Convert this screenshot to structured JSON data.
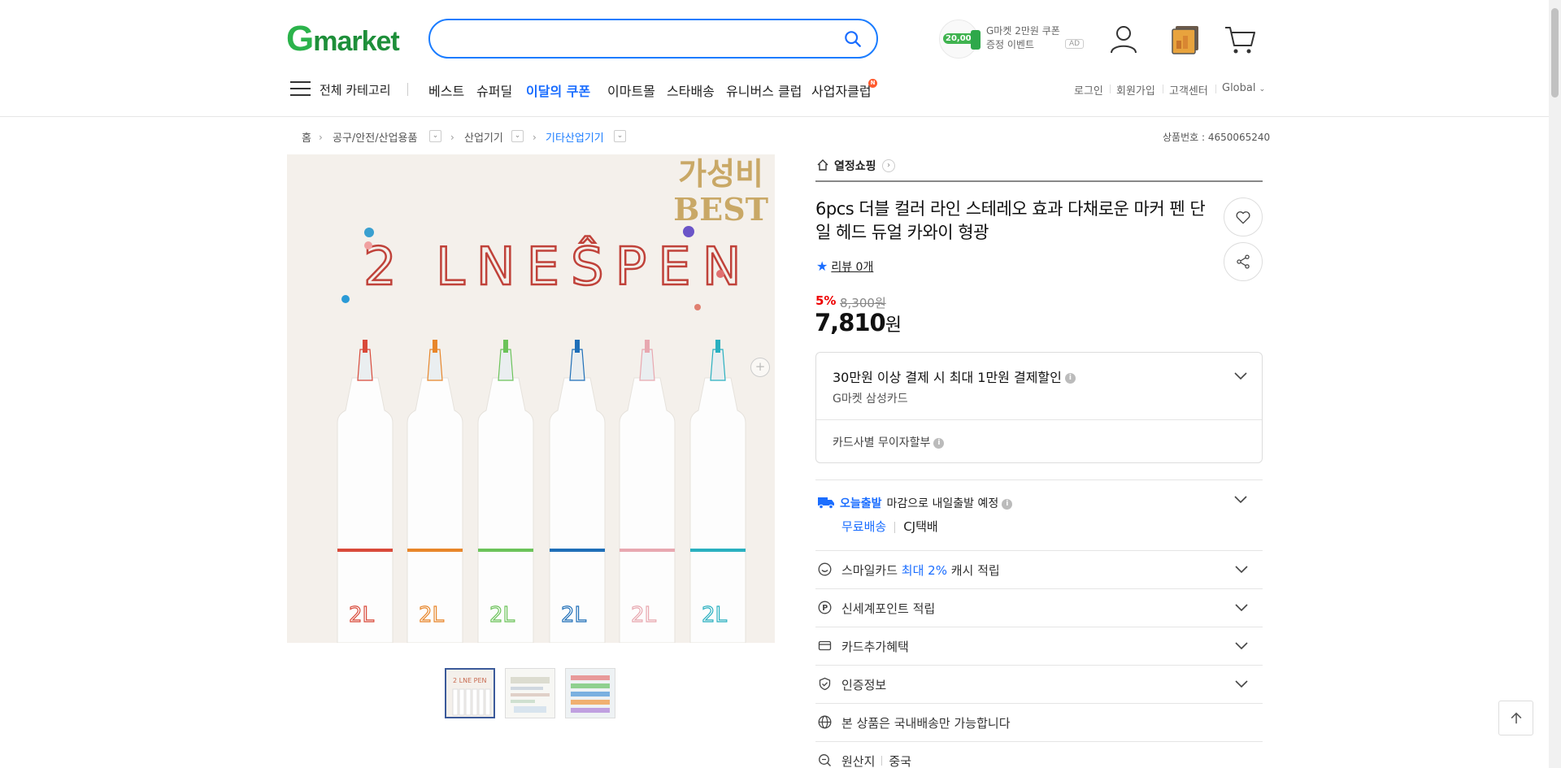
{
  "header": {
    "logo": {
      "g": "G",
      "rest": "market"
    },
    "search": {
      "value": "",
      "placeholder": ""
    },
    "promo": {
      "amount": "20,000",
      "line1": "G마켓 2만원 쿠폰",
      "line2": "증정 이벤트",
      "ad": "AD"
    },
    "all_category": "전체 카테고리",
    "nav": [
      "베스트",
      "슈퍼딜",
      "이달의 쿠폰",
      "이마트몰",
      "스타배송",
      "유니버스 클럽",
      "사업자클럽"
    ],
    "nav_badge": "N",
    "util": [
      "로그인",
      "회원가입",
      "고객센터",
      "Global"
    ]
  },
  "breadcrumb": {
    "items": [
      "홈",
      "공구/안전/산업용품",
      "산업기기",
      "기타산업기기"
    ],
    "product_no": "상품번호 : 4650065240"
  },
  "image": {
    "badge_line1": "가성비",
    "badge_line2": "BEST",
    "product_text": "2 LNEŜPEN"
  },
  "product": {
    "shop": "열정쇼핑",
    "title": "6pcs 더블 컬러 라인 스테레오 효과 다채로운 마커 펜 단일 헤드 듀얼 카와이 형광",
    "review": "리뷰 0개",
    "discount": "5%",
    "original_price": "8,300원",
    "price": "7,810",
    "price_unit": "원"
  },
  "card_benefit": {
    "title": "30만원 이상 결제 시 최대 1만원 결제할인",
    "card": "G마켓 삼성카드",
    "installment": "카드사별 무이자할부"
  },
  "shipping": {
    "today_label": "오늘출발",
    "today_text": "마감으로 내일출발 예정",
    "free": "무료배송",
    "carrier": "CJ택배"
  },
  "rows": {
    "smilecard_pre": "스마일카드 ",
    "smilecard_hl": "최대 2%",
    "smilecard_post": " 캐시 적립",
    "shinsegae": "신세계포인트 적립",
    "card_extra": "카드추가혜택",
    "cert": "인증정보",
    "domestic": "본 상품은 국내배송만 가능합니다",
    "origin_label": "원산지",
    "origin_value": "중국"
  },
  "colors": {
    "accent": "#1a6dff",
    "brand_green": "#2bb34b",
    "sale_red": "#e00000"
  }
}
